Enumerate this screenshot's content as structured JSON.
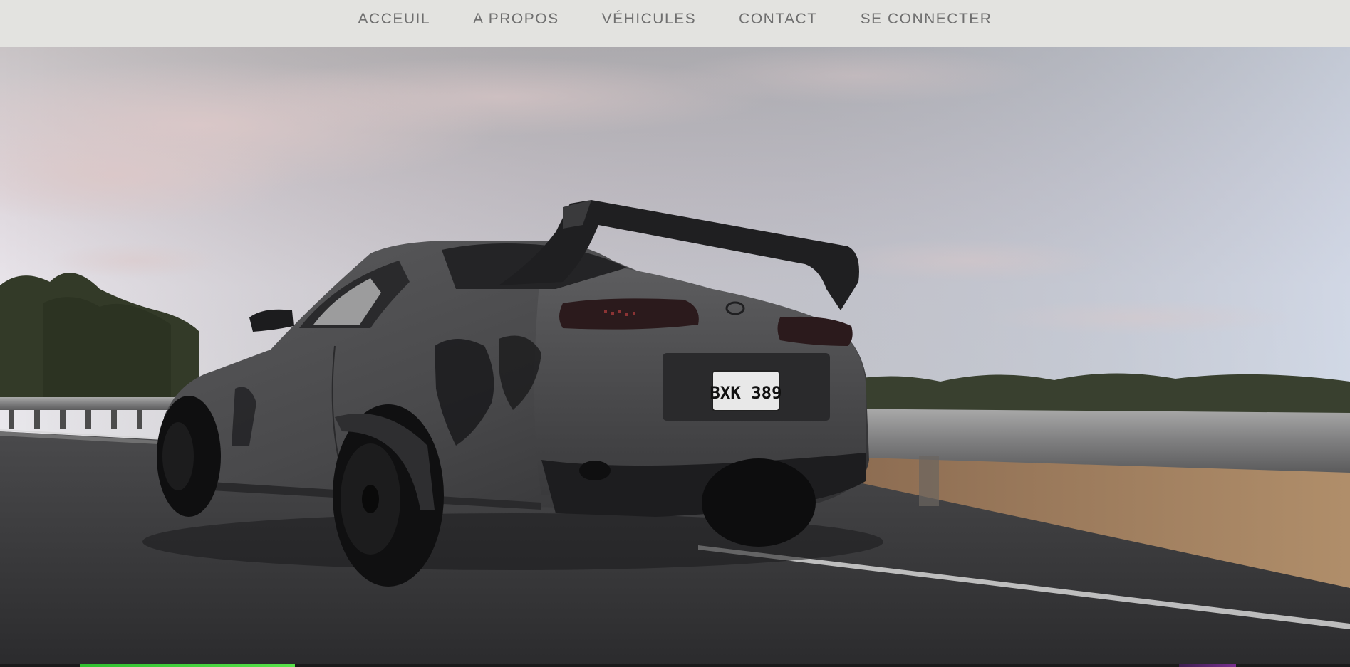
{
  "nav": {
    "items": [
      {
        "label": "ACCEUIL"
      },
      {
        "label": "A PROPOS"
      },
      {
        "label": "VÉHICULES"
      },
      {
        "label": "CONTACT"
      },
      {
        "label": "SE CONNECTER"
      }
    ]
  },
  "hero": {
    "image": "matte-grey-sports-car-on-highway-photo",
    "plate_text": "BXK 389",
    "video_progress": 0.19
  },
  "colors": {
    "nav_background": "#e3e3e0",
    "nav_text": "#6f6f6f",
    "progress_fill": "#2fbf2f"
  }
}
